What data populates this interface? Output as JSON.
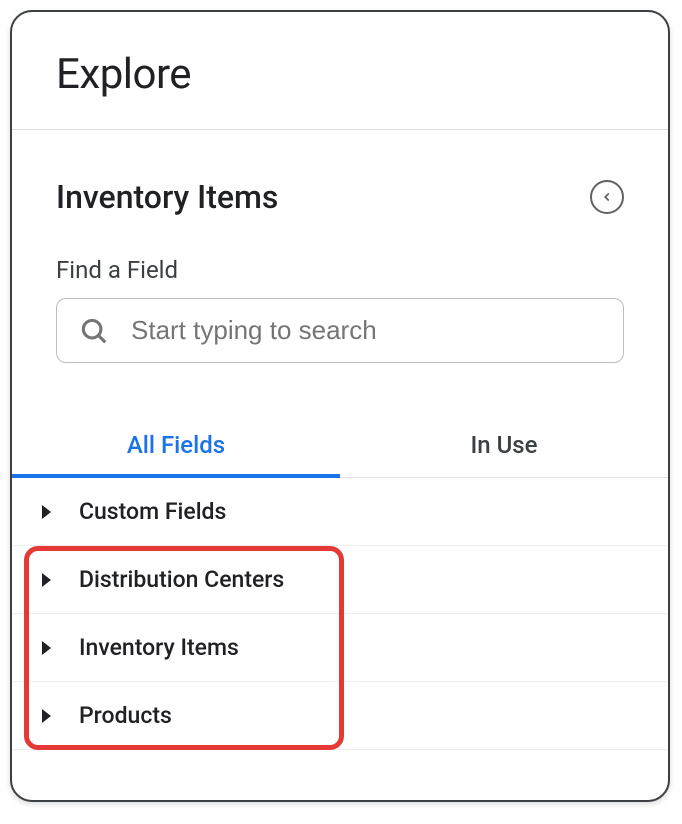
{
  "header": {
    "title": "Explore"
  },
  "section": {
    "title": "Inventory Items",
    "search_label": "Find a Field",
    "search_placeholder": "Start typing to search"
  },
  "tabs": {
    "all": "All Fields",
    "in_use": "In Use"
  },
  "fields": [
    {
      "label": "Custom Fields"
    },
    {
      "label": "Distribution Centers"
    },
    {
      "label": "Inventory Items"
    },
    {
      "label": "Products"
    }
  ]
}
